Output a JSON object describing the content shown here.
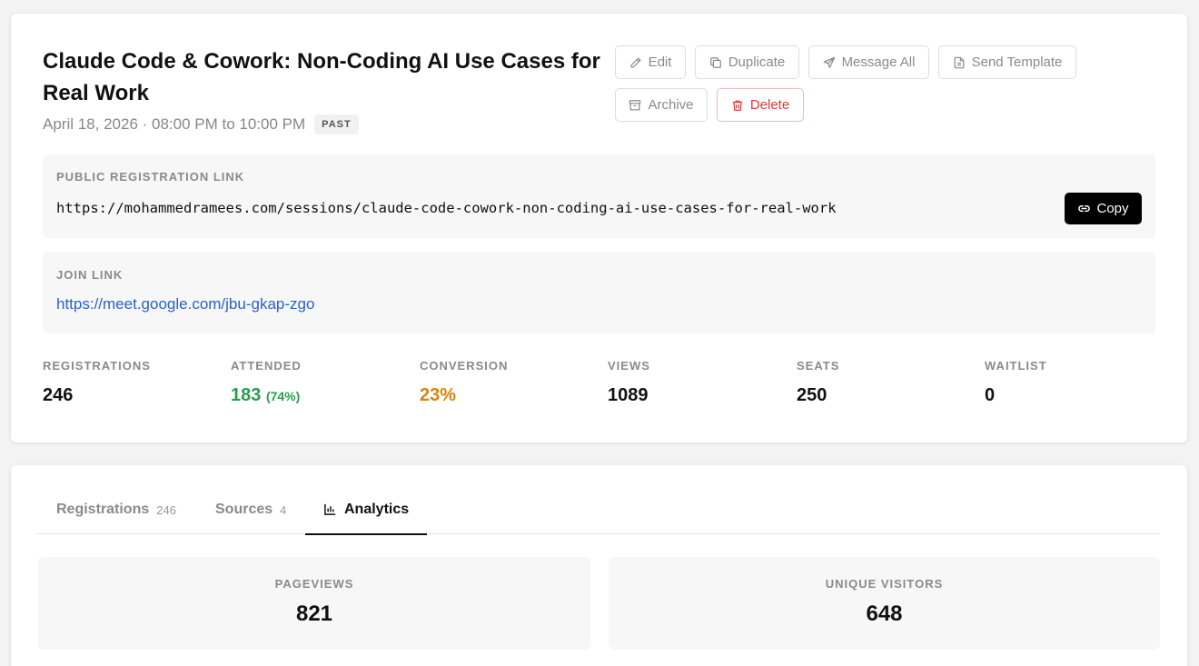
{
  "session": {
    "title": "Claude Code & Cowork: Non-Coding AI Use Cases for Real Work",
    "date_text": "April 18, 2026 · 08:00 PM to 10:00 PM",
    "status_badge": "PAST"
  },
  "actions": {
    "edit": "Edit",
    "duplicate": "Duplicate",
    "message_all": "Message All",
    "send_template": "Send Template",
    "archive": "Archive",
    "delete": "Delete"
  },
  "registration_link": {
    "label": "PUBLIC REGISTRATION LINK",
    "url": "https://mohammedramees.com/sessions/claude-code-cowork-non-coding-ai-use-cases-for-real-work",
    "copy_label": "Copy"
  },
  "join_link": {
    "label": "JOIN LINK",
    "url": "https://meet.google.com/jbu-gkap-zgo"
  },
  "stats": {
    "registrations": {
      "label": "REGISTRATIONS",
      "value": "246"
    },
    "attended": {
      "label": "ATTENDED",
      "value": "183",
      "sub": "(74%)"
    },
    "conversion": {
      "label": "CONVERSION",
      "value": "23%"
    },
    "views": {
      "label": "VIEWS",
      "value": "1089"
    },
    "seats": {
      "label": "SEATS",
      "value": "250"
    },
    "waitlist": {
      "label": "WAITLIST",
      "value": "0"
    }
  },
  "tabs": [
    {
      "label": "Registrations",
      "count": "246"
    },
    {
      "label": "Sources",
      "count": "4"
    },
    {
      "label": "Analytics",
      "active": true
    }
  ],
  "analytics": {
    "pageviews": {
      "label": "PAGEVIEWS",
      "value": "821"
    },
    "unique_visitors": {
      "label": "UNIQUE VISITORS",
      "value": "648"
    }
  },
  "colors": {
    "green": "#2a9d4b",
    "orange": "#d4850f",
    "link_blue": "#2b62c9",
    "delete_red": "#d63b3b"
  },
  "icons": [
    "pencil-icon",
    "duplicate-icon",
    "send-icon",
    "file-icon",
    "archive-icon",
    "trash-icon",
    "link-icon",
    "bar-chart-icon"
  ]
}
